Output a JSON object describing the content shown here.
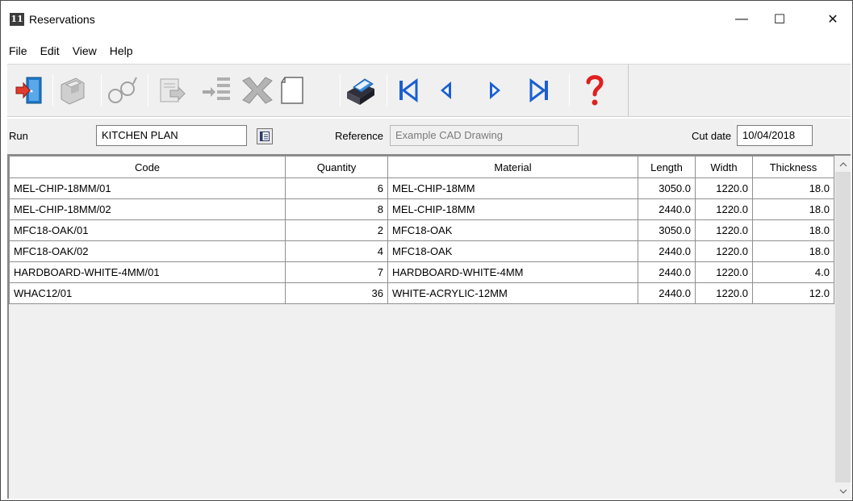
{
  "window": {
    "title": "Reservations",
    "icon_label": "11",
    "controls": {
      "minimize": "—",
      "maximize": "☐",
      "close": "✕"
    }
  },
  "menu": [
    "File",
    "Edit",
    "View",
    "Help"
  ],
  "toolbar": {
    "buttons": [
      "exit-icon",
      "save-icon",
      "view-icon",
      "copy-icon",
      "move-list-icon",
      "delete-icon",
      "new-page-icon",
      "print-icon",
      "first-record-icon",
      "previous-record-icon",
      "next-record-icon",
      "last-record-icon",
      "help-icon"
    ],
    "colors": {
      "exit": "#1f78c8",
      "arrow": "#1a5fd0",
      "help": "#e02020",
      "disabled": "#a0a0a0"
    }
  },
  "form": {
    "run_label": "Run",
    "run_value": "KITCHEN PLAN",
    "reference_label": "Reference",
    "reference_value": "Example CAD Drawing",
    "cut_date_label": "Cut date",
    "cut_date_value": "10/04/2018"
  },
  "table": {
    "columns": [
      "Code",
      "Quantity",
      "Material",
      "Length",
      "Width",
      "Thickness"
    ],
    "rows": [
      [
        "MEL-CHIP-18MM/01",
        "6",
        "MEL-CHIP-18MM",
        "3050.0",
        "1220.0",
        "18.0"
      ],
      [
        "MEL-CHIP-18MM/02",
        "8",
        "MEL-CHIP-18MM",
        "2440.0",
        "1220.0",
        "18.0"
      ],
      [
        "MFC18-OAK/01",
        "2",
        "MFC18-OAK",
        "3050.0",
        "1220.0",
        "18.0"
      ],
      [
        "MFC18-OAK/02",
        "4",
        "MFC18-OAK",
        "2440.0",
        "1220.0",
        "18.0"
      ],
      [
        "HARDBOARD-WHITE-4MM/01",
        "7",
        "HARDBOARD-WHITE-4MM",
        "2440.0",
        "1220.0",
        "4.0"
      ],
      [
        "WHAC12/01",
        "36",
        "WHITE-ACRYLIC-12MM",
        "2440.0",
        "1220.0",
        "12.0"
      ]
    ]
  }
}
